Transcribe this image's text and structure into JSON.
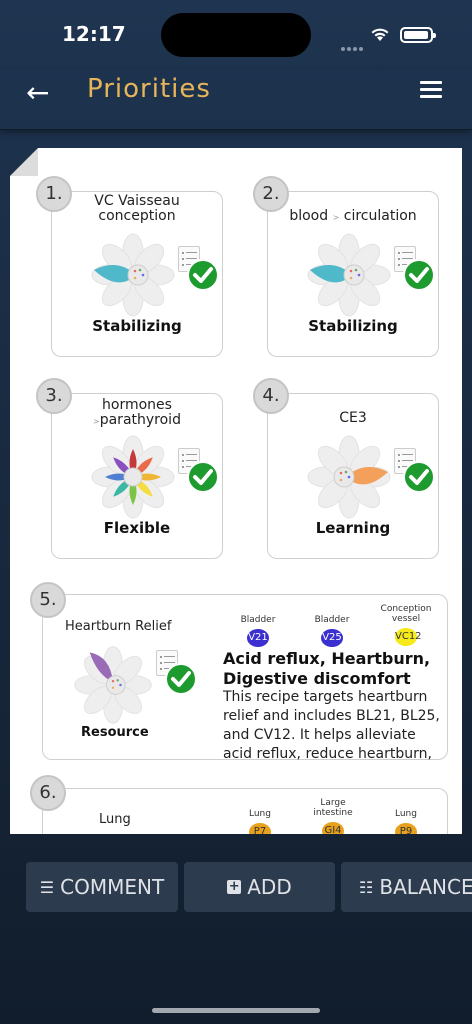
{
  "status": {
    "time": "12:17"
  },
  "header": {
    "back_icon": "←",
    "title": "Priorities"
  },
  "cards": [
    {
      "number": "1.",
      "title_line1": "VC Vaisseau",
      "title_line2": "conception",
      "label": "Stabilizing",
      "petal_color": "#4fb9c9"
    },
    {
      "number": "2.",
      "title_line1": "blood",
      "title_sep": ">",
      "title_line1b": "circulation",
      "label": "Stabilizing",
      "petal_color": "#4fb9c9"
    },
    {
      "number": "3.",
      "title_line1": "hormones",
      "title_sep": ">",
      "title_line2": "parathyroid",
      "label": "Flexible"
    },
    {
      "number": "4.",
      "title_line1": "CE3",
      "label": "Learning",
      "petal_color": "#f2a05a"
    }
  ],
  "card5": {
    "number": "5.",
    "title": "Heartburn Relief",
    "label": "Resource",
    "petal_color": "#9a6bb7",
    "nodes": [
      {
        "name": "Bladder",
        "code": "V21",
        "color": "#3b2fcf",
        "text_color": "#ffffff"
      },
      {
        "name": "Bladder",
        "code": "V25",
        "color": "#3b2fcf",
        "text_color": "#ffffff"
      },
      {
        "name_line1": "Conception",
        "name_line2": "vessel",
        "code": "VC12",
        "color": "#f6ea1a",
        "text_color": "#333333"
      }
    ],
    "desc_title": "Acid reflux, Heartburn, Digestive discomfort",
    "desc_body": "This recipe targets heartburn relief and includes BL21, BL25, and CV12. It helps alleviate acid reflux, reduce heartburn,"
  },
  "card6": {
    "number": "6.",
    "title": "Lung",
    "nodes": [
      {
        "name": "Lung",
        "code": "P7",
        "color": "#e7a11c"
      },
      {
        "name_line1": "Large",
        "name_line2": "intestine",
        "code": "GI4",
        "color": "#e7a11c"
      },
      {
        "name": "Lung",
        "code": "P9",
        "color": "#e7a11c"
      }
    ]
  },
  "toolbar": {
    "comment_label": "COMMENT",
    "add_label": "ADD",
    "balance_label": "BALANCE"
  }
}
